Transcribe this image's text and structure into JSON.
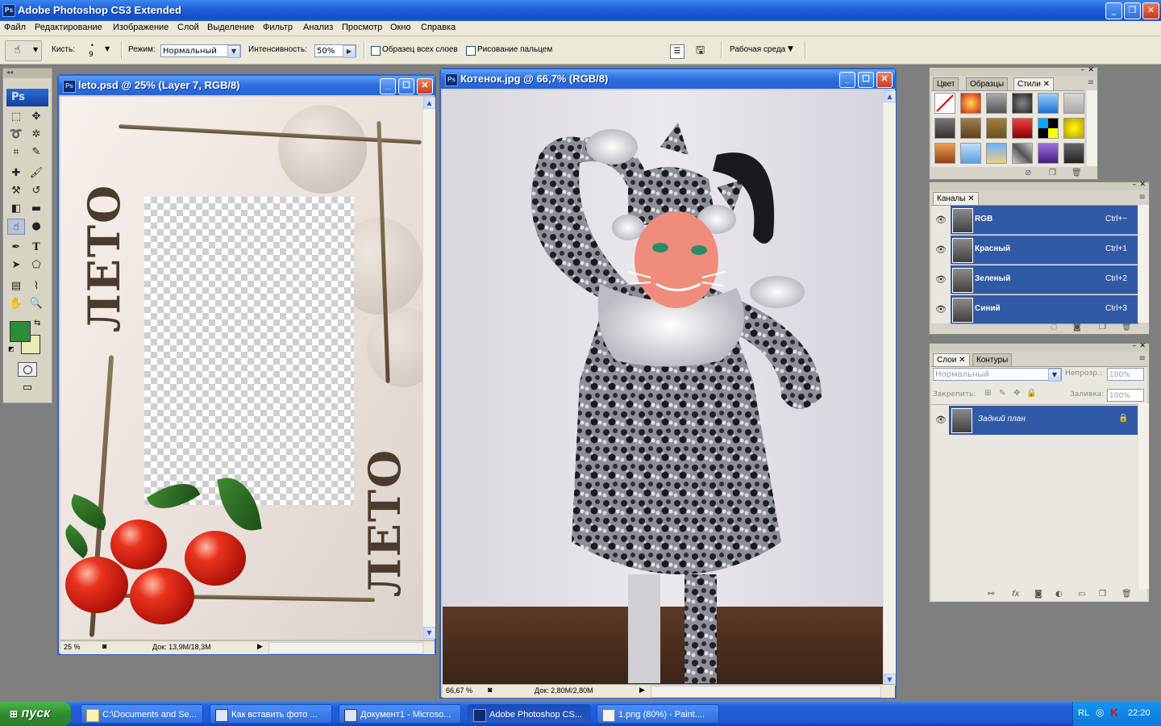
{
  "app": {
    "title": "Adobe Photoshop CS3 Extended",
    "icon": "ps-app-icon"
  },
  "menu": [
    "Файл",
    "Редактирование",
    "Изображение",
    "Слой",
    "Выделение",
    "Фильтр",
    "Анализ",
    "Просмотр",
    "Окно",
    "Справка"
  ],
  "options": {
    "brush_label": "Кисть:",
    "brush_size": "9",
    "mode_label": "Режим:",
    "mode_value": "Нормальный",
    "strength_label": "Интенсивность:",
    "strength_value": "50%",
    "sample_all_label": "Образец всех слоев",
    "finger_label": "Рисование пальцем",
    "workspace_label": "Рабочая среда"
  },
  "tools": {
    "logo": "Ps",
    "foreground_color": "#2e8b3a",
    "background_color": "#e8ecb6"
  },
  "doc_leto": {
    "title": "leto.psd @ 25% (Layer 7, RGB/8)",
    "zoom": "25 %",
    "doc_size": "Док: 13,9M/18,3M",
    "word": "ЛЕТО"
  },
  "doc_kitten": {
    "title": "Котенок.jpg @ 66,7% (RGB/8)",
    "zoom": "66,67 %",
    "doc_size": "Док: 2,80M/2,80M"
  },
  "styles_panel": {
    "tabs": [
      "Цвет",
      "Образцы",
      "Стили"
    ],
    "active_tab": "Стили"
  },
  "channels_panel": {
    "tab": "Каналы",
    "rows": [
      {
        "name": "RGB",
        "shortcut": "Ctrl+~"
      },
      {
        "name": "Красный",
        "shortcut": "Ctrl+1"
      },
      {
        "name": "Зеленый",
        "shortcut": "Ctrl+2"
      },
      {
        "name": "Синий",
        "shortcut": "Ctrl+3"
      }
    ]
  },
  "layers_panel": {
    "tabs": [
      "Слои",
      "Контуры"
    ],
    "blend_mode": "Нормальный",
    "opacity_label": "Непрозр.:",
    "opacity_value": "100%",
    "lock_label": "Закрепить:",
    "fill_label": "Заливка:",
    "fill_value": "100%",
    "layer_name": "Задний план"
  },
  "taskbar": {
    "start": "пуск",
    "tasks": [
      "C:\\Documents and Se...",
      "Как вставить фото ...",
      "Документ1 - Microso...",
      "Adobe Photoshop CS...",
      "1.png (80%) - Paint...."
    ],
    "lang": "RL",
    "clock": "22:20"
  }
}
